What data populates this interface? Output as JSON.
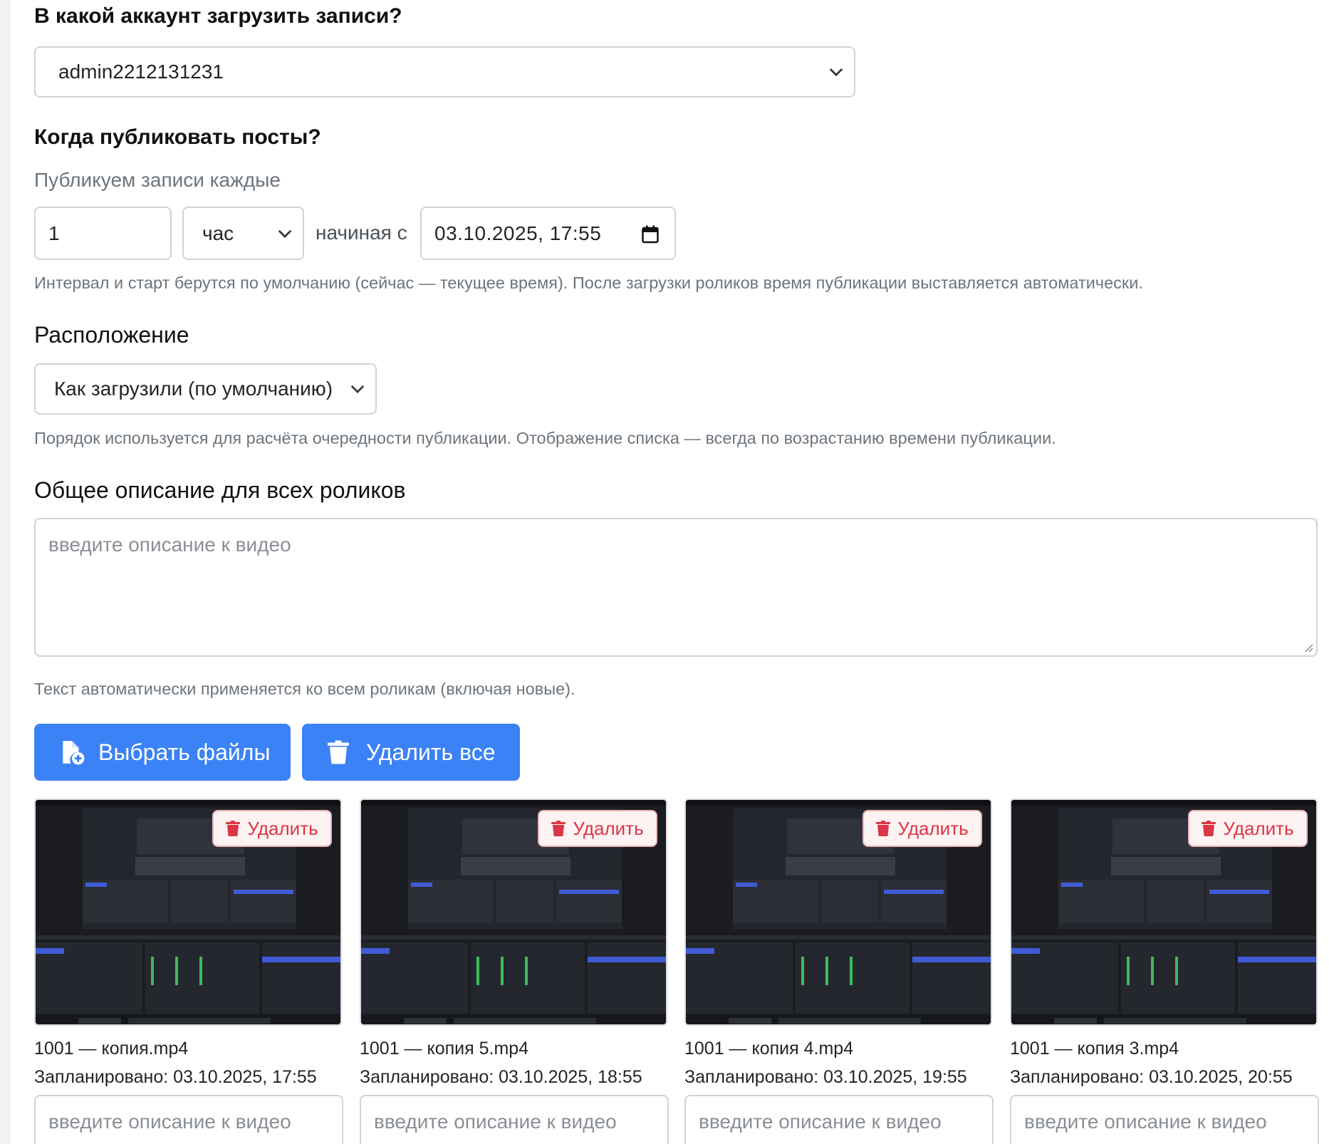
{
  "account": {
    "heading": "В какой аккаунт загрузить записи?",
    "selected": "admin2212131231"
  },
  "schedule": {
    "heading": "Когда публиковать посты?",
    "label": "Публикуем записи каждые",
    "interval_value": "1",
    "interval_unit": "час",
    "start_label": "начиная с",
    "start_datetime": "03.10.2025, 17:55",
    "help": "Интервал и старт берутся по умолчанию (сейчас — текущее время). После загрузки роликов время публикации выставляется автоматически."
  },
  "order": {
    "heading": "Расположение",
    "selected": "Как загрузили (по умолчанию)",
    "help": "Порядок используется для расчёта очередности публикации. Отображение списка — всегда по возрастанию времени публикации."
  },
  "description": {
    "heading": "Общее описание для всех роликов",
    "placeholder": "введите описание к видео",
    "help": "Текст автоматически применяется ко всем роликам (включая новые)."
  },
  "actions": {
    "choose_files": "Выбрать файлы",
    "delete_all": "Удалить все"
  },
  "videos": [
    {
      "name": "1001 — копия.mp4",
      "scheduled": "Запланировано: 03.10.2025, 17:55",
      "delete_label": "Удалить",
      "placeholder": "введите описание к видео"
    },
    {
      "name": "1001 — копия 5.mp4",
      "scheduled": "Запланировано: 03.10.2025, 18:55",
      "delete_label": "Удалить",
      "placeholder": "введите описание к видео"
    },
    {
      "name": "1001 — копия 4.mp4",
      "scheduled": "Запланировано: 03.10.2025, 19:55",
      "delete_label": "Удалить",
      "placeholder": "введите описание к видео"
    },
    {
      "name": "1001 — копия 3.mp4",
      "scheduled": "Запланировано: 03.10.2025, 20:55",
      "delete_label": "Удалить",
      "placeholder": "введите описание к видео"
    }
  ],
  "colors": {
    "primary": "#3b82f6",
    "danger": "#dc3545",
    "muted": "#6c757d",
    "border": "#ced4da"
  },
  "icons": {
    "select_caret": "chevron-down-icon",
    "date_picker": "calendar-icon",
    "choose_files": "file-plus-icon",
    "delete": "trash-icon"
  }
}
